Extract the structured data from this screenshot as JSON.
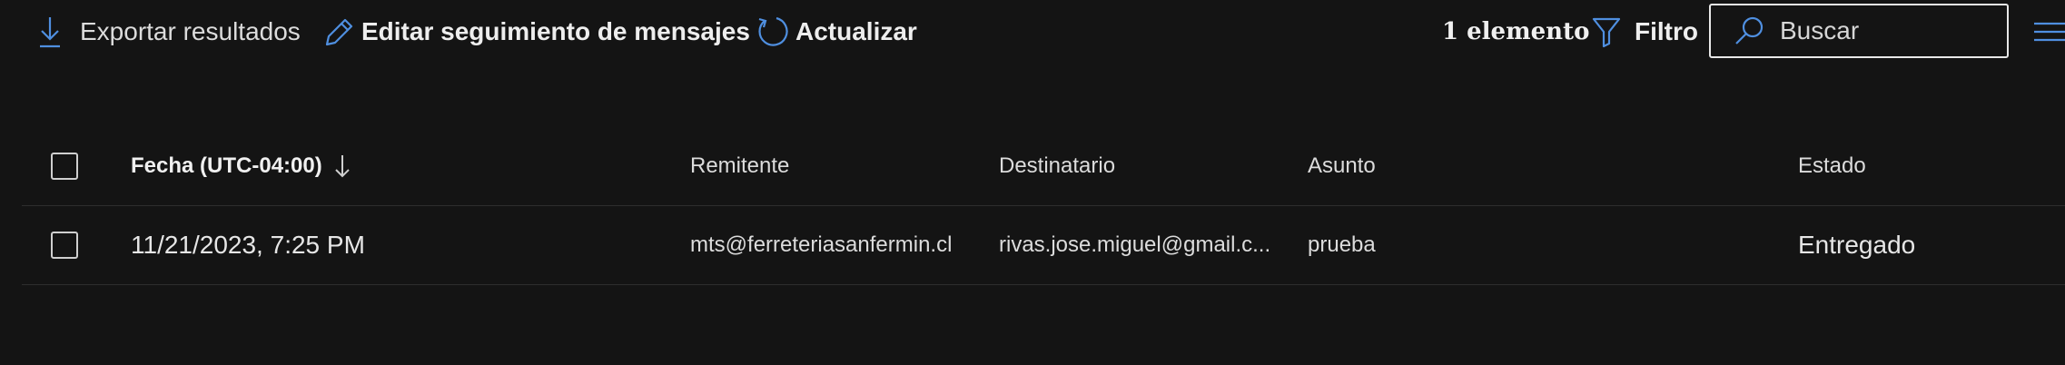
{
  "toolbar": {
    "export_label": "Exportar resultados",
    "edit_label": "Editar seguimiento de mensajes",
    "refresh_label": "Actualizar",
    "count_label": "1 elemento",
    "filter_label": "Filtro"
  },
  "search": {
    "placeholder": "Buscar",
    "value": ""
  },
  "table": {
    "headers": {
      "date": "Fecha (UTC-04:00)",
      "sender": "Remitente",
      "recipient": "Destinatario",
      "subject": "Asunto",
      "status": "Estado"
    },
    "rows": [
      {
        "date": "11/21/2023, 7:25 PM",
        "sender": "mts@ferreteriasanfermin.cl",
        "recipient": "rivas.jose.miguel@gmail.c...",
        "subject": "prueba",
        "status": "Entregado"
      }
    ]
  },
  "colors": {
    "accent": "#4f8fe0",
    "background": "#141414",
    "text": "#e6e6e6"
  },
  "icons": [
    "download-icon",
    "pencil-icon",
    "refresh-icon",
    "filter-icon",
    "search-icon",
    "sort-descending-icon",
    "column-options-icon"
  ]
}
